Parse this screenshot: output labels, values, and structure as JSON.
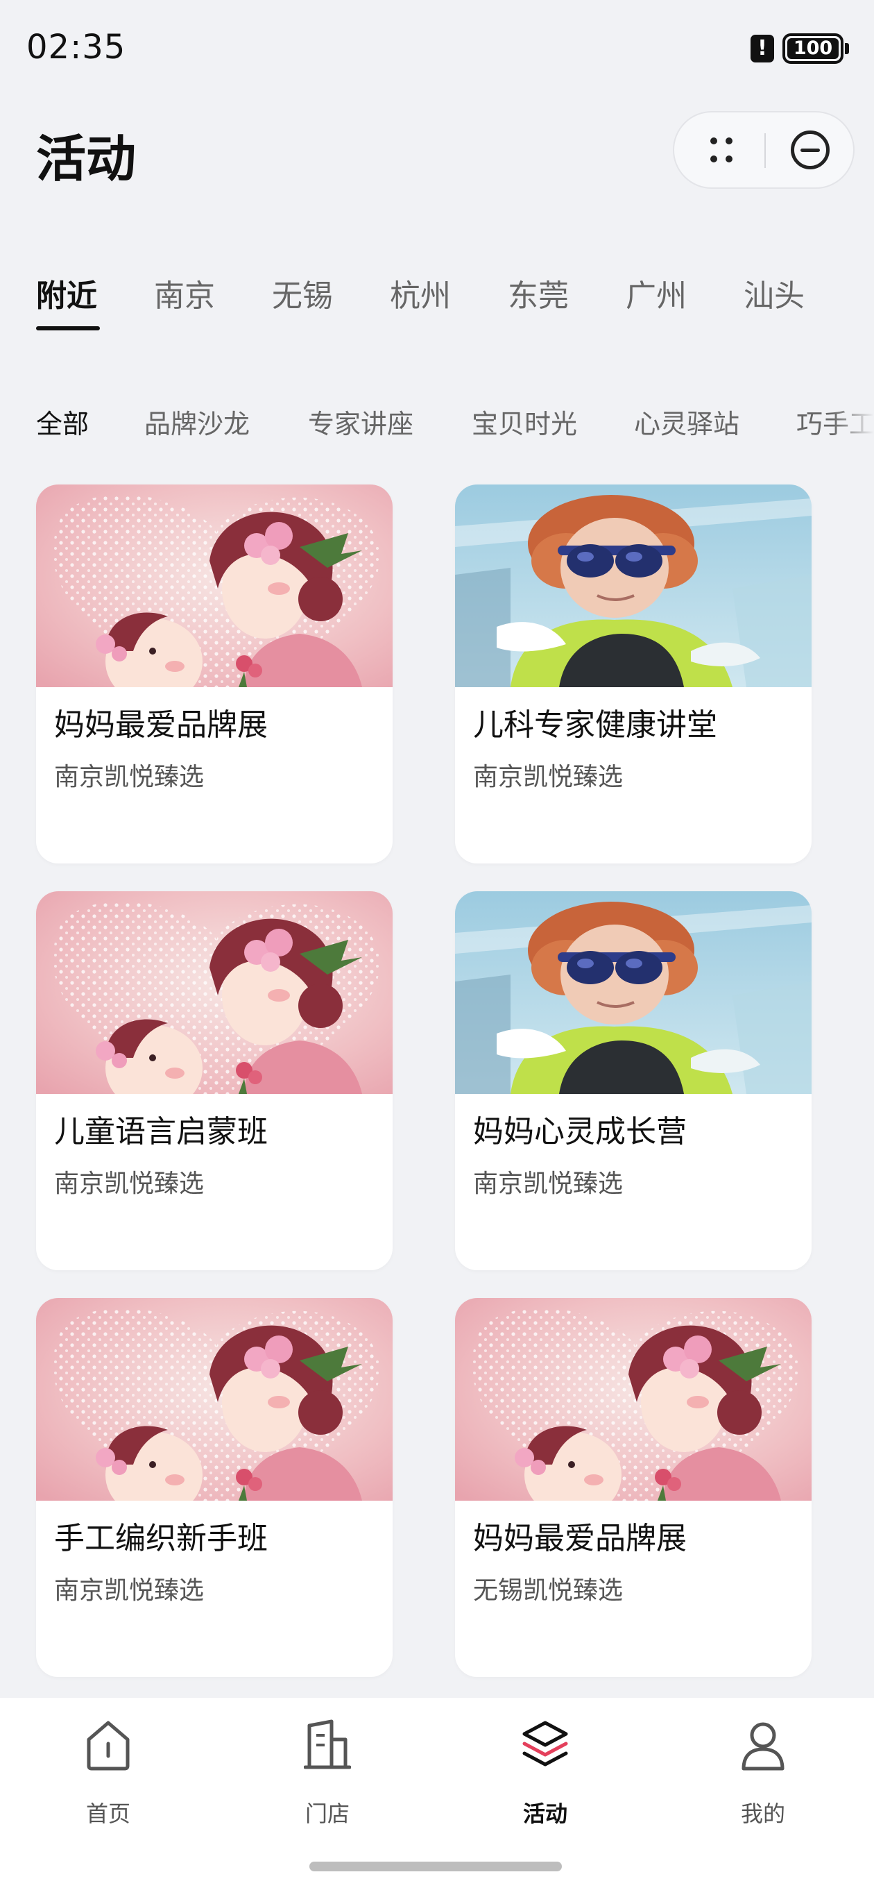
{
  "status_bar": {
    "time": "02:35",
    "battery": "100"
  },
  "header": {
    "title": "活动"
  },
  "city_tabs": [
    "附近",
    "南京",
    "无锡",
    "杭州",
    "东莞",
    "广州",
    "汕头"
  ],
  "category_tabs": [
    "全部",
    "品牌沙龙",
    "专家讲座",
    "宝贝时光",
    "心灵驿站",
    "巧手工"
  ],
  "cards": [
    {
      "title": "妈妈最爱品牌展",
      "subtitle": "南京凯悦臻选",
      "image": "mother-baby-illustration"
    },
    {
      "title": "儿科专家健康讲堂",
      "subtitle": "南京凯悦臻选",
      "image": "child-swimming-photo"
    },
    {
      "title": "儿童语言启蒙班",
      "subtitle": "南京凯悦臻选",
      "image": "mother-baby-illustration"
    },
    {
      "title": "妈妈心灵成长营",
      "subtitle": "南京凯悦臻选",
      "image": "child-swimming-photo"
    },
    {
      "title": "手工编织新手班",
      "subtitle": "南京凯悦臻选",
      "image": "mother-baby-illustration"
    },
    {
      "title": "妈妈最爱品牌展",
      "subtitle": "无锡凯悦臻选",
      "image": "mother-baby-illustration"
    }
  ],
  "bottom_nav": [
    {
      "label": "首页",
      "icon": "home-icon"
    },
    {
      "label": "门店",
      "icon": "store-icon"
    },
    {
      "label": "活动",
      "icon": "layers-icon",
      "active": true
    },
    {
      "label": "我的",
      "icon": "user-icon"
    }
  ],
  "colors": {
    "background": "#f1f2f5",
    "accent": "#e4405c",
    "text": "#111111"
  }
}
